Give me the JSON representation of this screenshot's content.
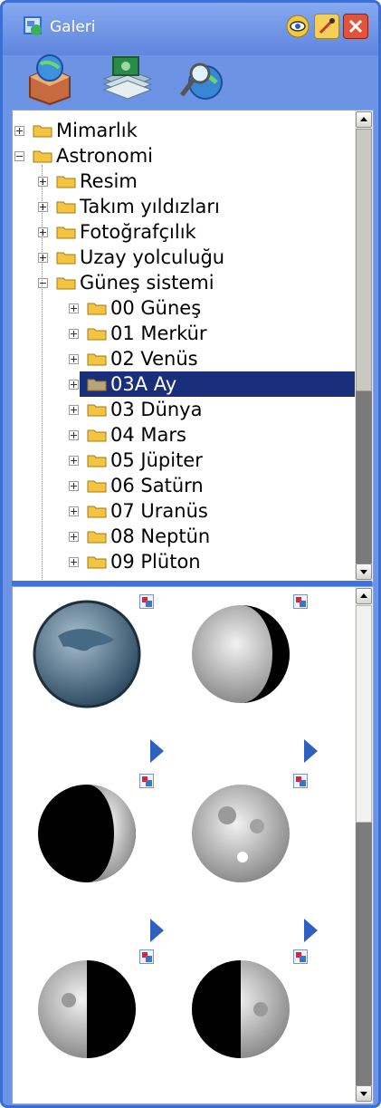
{
  "window": {
    "title": "Galeri",
    "title_icon": "gallery-icon",
    "buttons": [
      {
        "name": "eye-icon"
      },
      {
        "name": "pin-icon"
      },
      {
        "name": "close-icon"
      }
    ]
  },
  "toolbar": {
    "tools": [
      {
        "name": "open-box-globe-icon"
      },
      {
        "name": "stack-images-icon"
      },
      {
        "name": "search-globe-icon"
      }
    ]
  },
  "tree": {
    "items": [
      {
        "label": "Mimarlık",
        "level": 0,
        "expanded": false
      },
      {
        "label": "Astronomi",
        "level": 0,
        "expanded": true
      },
      {
        "label": "Resim",
        "level": 1,
        "expanded": false
      },
      {
        "label": "Takım yıldızları",
        "level": 1,
        "expanded": false
      },
      {
        "label": "Fotoğrafçılık",
        "level": 1,
        "expanded": false
      },
      {
        "label": "Uzay yolculuğu",
        "level": 1,
        "expanded": false
      },
      {
        "label": "Güneş sistemi",
        "level": 1,
        "expanded": true
      },
      {
        "label": "00 Güneş",
        "level": 2,
        "expanded": false
      },
      {
        "label": "01 Merkür",
        "level": 2,
        "expanded": false
      },
      {
        "label": "02 Venüs",
        "level": 2,
        "expanded": false
      },
      {
        "label": "03A Ay",
        "level": 2,
        "expanded": false,
        "selected": true
      },
      {
        "label": "03 Dünya",
        "level": 2,
        "expanded": false
      },
      {
        "label": "04 Mars",
        "level": 2,
        "expanded": false
      },
      {
        "label": "05 Jüpiter",
        "level": 2,
        "expanded": false
      },
      {
        "label": "06 Satürn",
        "level": 2,
        "expanded": false
      },
      {
        "label": "07 Uranüs",
        "level": 2,
        "expanded": false
      },
      {
        "label": "08 Neptün",
        "level": 2,
        "expanded": false
      },
      {
        "label": "09 Plüton",
        "level": 2,
        "expanded": false
      }
    ]
  },
  "gallery": {
    "thumbnails": [
      {
        "name": "moon-thumb-full-dark"
      },
      {
        "name": "moon-thumb-waning-crescent"
      },
      {
        "name": "moon-thumb-waxing-crescent"
      },
      {
        "name": "moon-thumb-full"
      },
      {
        "name": "moon-thumb-last-quarter"
      },
      {
        "name": "moon-thumb-first-quarter"
      }
    ]
  },
  "colors": {
    "frame": "#6d93e4",
    "selection": "#1a2f7c",
    "folder": "#f5c542"
  }
}
